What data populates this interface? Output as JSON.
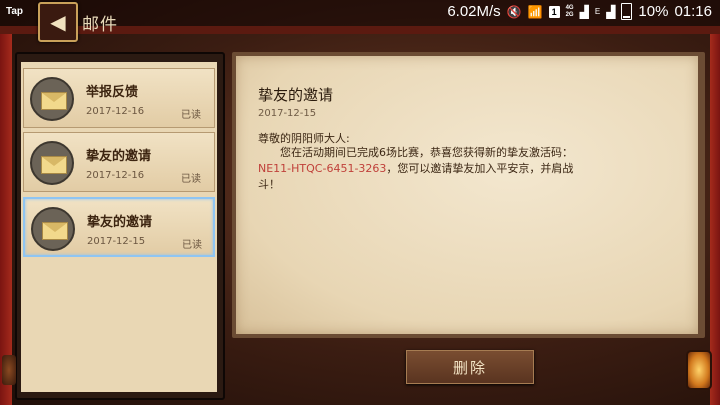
{
  "status_bar": {
    "left_label": "Tap",
    "speed": "6.02M/s",
    "network_badge": "1",
    "network_type_top": "4G",
    "network_type_bottom": "2G",
    "carrier_small": "E",
    "battery": "10%",
    "time": "01:16"
  },
  "header": {
    "title": "邮件"
  },
  "mail_list": [
    {
      "title": "举报反馈",
      "date": "2017-12-16",
      "status": "已读",
      "selected": false
    },
    {
      "title": "挚友的邀请",
      "date": "2017-12-16",
      "status": "已读",
      "selected": false
    },
    {
      "title": "挚友的邀请",
      "date": "2017-12-15",
      "status": "已读",
      "selected": true
    }
  ],
  "letter": {
    "title": "挚友的邀请",
    "date": "2017-12-15",
    "greeting": "尊敬的阴阳师大人:",
    "line1": "您在活动期间已完成6场比赛，恭喜您获得新的挚友激活码：",
    "code": "NE11-HTQC-6451-3263",
    "line2_after_code": "，您可以邀请挚友加入平安京，并肩战",
    "line3": "斗！"
  },
  "actions": {
    "delete_label": "删除"
  },
  "colors": {
    "code_red": "#c0403a",
    "selected_border": "#8fc5f2"
  }
}
